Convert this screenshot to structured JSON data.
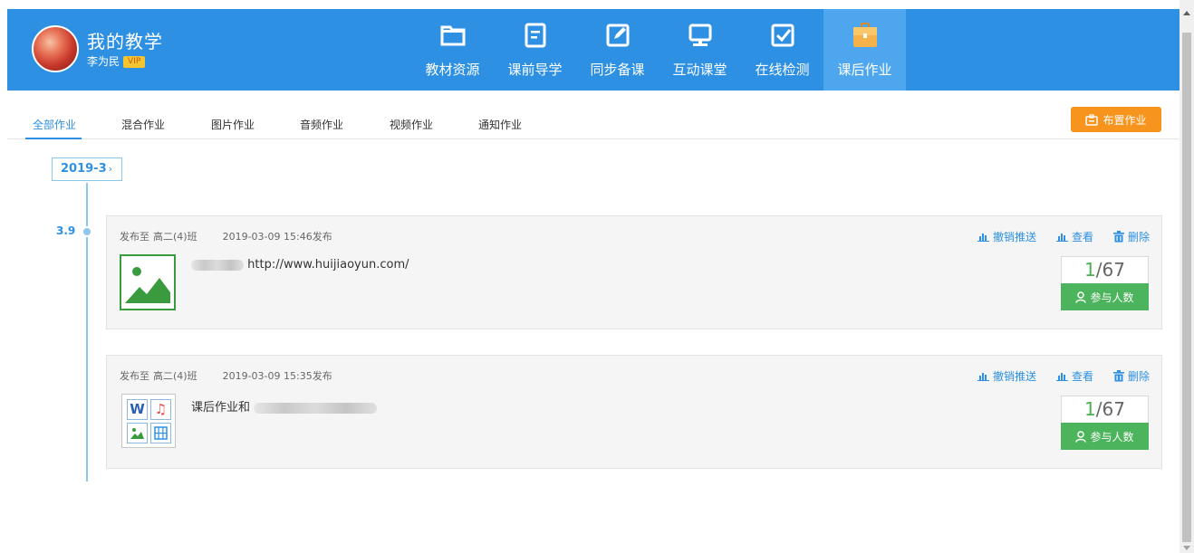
{
  "header": {
    "title": "我的教学",
    "user_name": "李为民",
    "badge": "VIP",
    "nav": [
      {
        "label": "教材资源",
        "icon": "folder-icon"
      },
      {
        "label": "课前导学",
        "icon": "document-icon"
      },
      {
        "label": "同步备课",
        "icon": "edit-icon"
      },
      {
        "label": "互动课堂",
        "icon": "monitor-icon"
      },
      {
        "label": "在线检测",
        "icon": "checkbox-icon"
      },
      {
        "label": "课后作业",
        "icon": "briefcase-icon",
        "active": true
      }
    ]
  },
  "tabs": [
    {
      "label": "全部作业",
      "active": true
    },
    {
      "label": "混合作业"
    },
    {
      "label": "图片作业"
    },
    {
      "label": "音频作业"
    },
    {
      "label": "视频作业"
    },
    {
      "label": "通知作业"
    }
  ],
  "assign_button": "布置作业",
  "timeline": {
    "month": "2019-3",
    "day": "3.9"
  },
  "homework": [
    {
      "published_to_label": "发布至",
      "class": "高二(4)班",
      "time": "2019-03-09 15:46发布",
      "text": "http://www.huijiaoyun.com/",
      "type": "image",
      "actions": [
        "撤销推送",
        "查看",
        "删除"
      ],
      "submitted": "1",
      "total": "/67",
      "participants_label": "参与人数"
    },
    {
      "published_to_label": "发布至",
      "class": "高二(4)班",
      "time": "2019-03-09 15:35发布",
      "text": "课后作业和",
      "type": "mixed",
      "actions": [
        "撤销推送",
        "查看",
        "删除"
      ],
      "submitted": "1",
      "total": "/67",
      "participants_label": "参与人数"
    }
  ],
  "colors": {
    "primary": "#2d90e3",
    "accent": "#f7941d",
    "success": "#4cb45c"
  }
}
